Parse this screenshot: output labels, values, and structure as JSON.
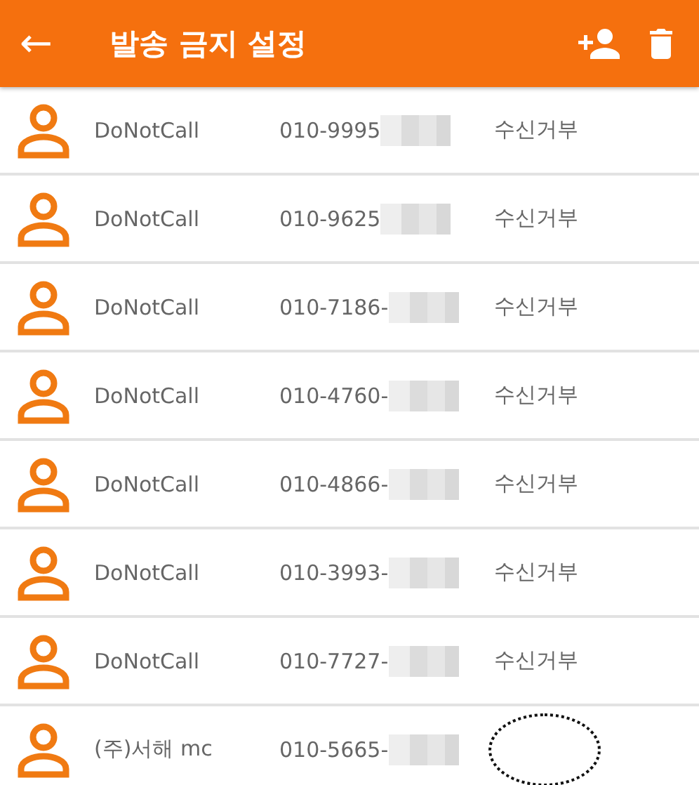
{
  "toolbar": {
    "back": "←",
    "title": "발송 금지 설정"
  },
  "rows": [
    {
      "name": "DoNotCall",
      "phone": "010-9995",
      "redacted": true,
      "status": "수신거부",
      "circled": false
    },
    {
      "name": "DoNotCall",
      "phone": "010-9625",
      "redacted": true,
      "status": "수신거부",
      "circled": false
    },
    {
      "name": "DoNotCall",
      "phone": "010-7186-",
      "redacted": true,
      "status": "수신거부",
      "circled": false
    },
    {
      "name": "DoNotCall",
      "phone": "010-4760-",
      "redacted": true,
      "status": "수신거부",
      "circled": false
    },
    {
      "name": "DoNotCall",
      "phone": "010-4866-",
      "redacted": true,
      "status": "수신거부",
      "circled": false
    },
    {
      "name": "DoNotCall",
      "phone": "010-3993-",
      "redacted": true,
      "status": "수신거부",
      "circled": false
    },
    {
      "name": "DoNotCall",
      "phone": "010-7727-",
      "redacted": true,
      "status": "수신거부",
      "circled": false
    },
    {
      "name": "(주)서해 mc",
      "phone": "010-5665-",
      "redacted": true,
      "circled": true
    }
  ]
}
